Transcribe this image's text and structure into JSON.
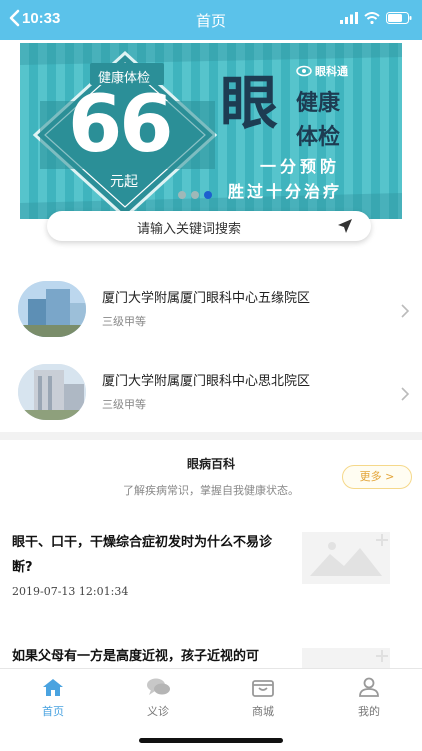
{
  "status_bar": {
    "time": "10:33"
  },
  "header": {
    "title": "首页"
  },
  "banner": {
    "check_label": "健康体检",
    "price": "66",
    "price_suffix": "元起",
    "eye_char": "眼",
    "headline_line1": "健康",
    "headline_line2": "体检",
    "logo_text": "眼科通",
    "slogan_line1": "一分预防",
    "slogan_line2": "胜过十分治疗",
    "colors": {
      "stripe_a": "#56c4cc",
      "stripe_b": "#3fb4be",
      "dark_text": "#1d3c52"
    },
    "page_count": 3,
    "active_page_index": 2
  },
  "search": {
    "placeholder": "请输入关键词搜索",
    "icon": "navigate-arrow-icon"
  },
  "hospitals": [
    {
      "name": "厦门大学附属厦门眼科中心五缘院区",
      "level": "三级甲等"
    },
    {
      "name": "厦门大学附属厦门眼科中心思北院区",
      "level": "三级甲等"
    }
  ],
  "encyclopedia": {
    "title": "眼病百科",
    "subtitle": "了解疾病常识，掌握自我健康状态。",
    "more_label": "更多 >",
    "articles": [
      {
        "title": "眼干、口干，干燥综合症初发时为什么不易诊断?",
        "date": "2019-07-13 12:01:34"
      },
      {
        "title": "如果父母有一方是高度近视，孩子近视的可",
        "date": ""
      }
    ]
  },
  "bottom_nav": [
    {
      "label": "首页",
      "icon": "home-icon",
      "active": true
    },
    {
      "label": "义诊",
      "icon": "chat-bubbles-icon",
      "active": false
    },
    {
      "label": "商城",
      "icon": "shop-icon",
      "active": false
    },
    {
      "label": "我的",
      "icon": "user-icon",
      "active": false
    }
  ],
  "colors": {
    "accent": "#5bc2ea",
    "nav_active": "#4aa3e0",
    "more_border": "#f5d88a",
    "more_text": "#e3a53a"
  }
}
